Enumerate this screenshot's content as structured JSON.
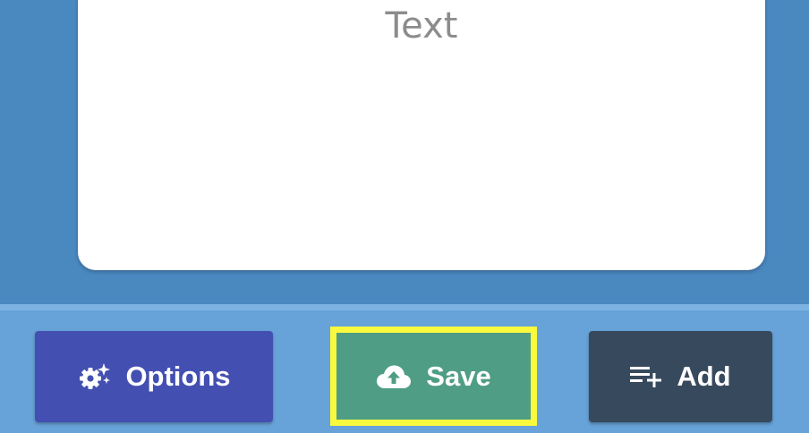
{
  "card": {
    "text": "Text"
  },
  "buttons": {
    "options": {
      "label": "Options",
      "icon": "gear-sparkle-icon"
    },
    "save": {
      "label": "Save",
      "icon": "cloud-upload-icon"
    },
    "add": {
      "label": "Add",
      "icon": "playlist-add-icon"
    }
  },
  "colors": {
    "background": "#4a88c0",
    "toolbar": "#67a2d8",
    "options": "#4350b1",
    "save": "#4f9d84",
    "save_highlight": "#f9f93d",
    "add": "#37495d"
  }
}
